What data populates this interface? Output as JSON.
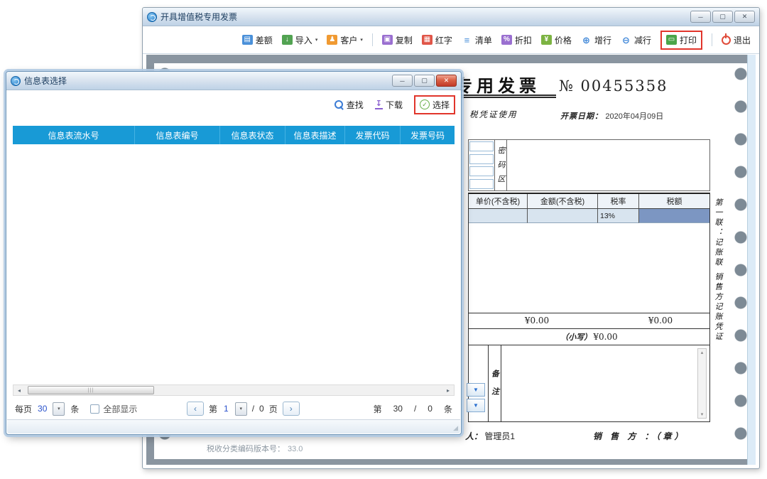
{
  "main_window": {
    "title": "开具增值税专用发票",
    "toolbar": {
      "balance": "差额",
      "import": "导入",
      "customer": "客户",
      "copy": "复制",
      "red_letter": "红字",
      "list": "清单",
      "discount": "折扣",
      "price": "价格",
      "add_row": "增行",
      "remove_row": "减行",
      "print": "打印",
      "exit": "退出"
    },
    "invoice": {
      "title_visible": "专用发票",
      "number_text": "№  00455358",
      "subtitle_visible": "税凭证使用",
      "date_label": "开票日期：",
      "date": "2020年04月09日",
      "password_area_label": "密码区",
      "columns": {
        "unit_price": "单价(不含税)",
        "amount": "金额(不含税)",
        "tax_rate": "税率",
        "tax": "税额"
      },
      "tax_rate_value": "13%",
      "amount_total": "¥0.00",
      "tax_total": "¥0.00",
      "small_total_label": "（小写）",
      "small_total": "¥0.00",
      "remarks_label": "备注",
      "issuer_label_visible": "人：",
      "issuer_value": "管理员1",
      "seller_stamp": "销 售 方 ：（章）",
      "copy_label": "第一联：记账联 销售方记账凭证"
    },
    "status_bar": {
      "label": "税收分类编码版本号：",
      "value": "33.0"
    }
  },
  "dialog": {
    "title": "信息表选择",
    "toolbar": {
      "search": "查找",
      "download": "下载",
      "select": "选择"
    },
    "table": {
      "headers": [
        "信息表流水号",
        "信息表编号",
        "信息表状态",
        "信息表描述",
        "发票代码",
        "发票号码"
      ]
    },
    "pagination": {
      "per_page_label": "每页",
      "per_page": "30",
      "per_page_unit": "条",
      "show_all_label": "全部显示",
      "page_label": "第",
      "current_page": "1",
      "page_divider": "/",
      "total_pages": "0",
      "page_unit": "页",
      "record_label": "第",
      "record_count": "30",
      "record_divider": "/",
      "record_total": "0",
      "record_unit": "条"
    }
  },
  "icons": {
    "balance": "▤",
    "import": "↓",
    "customer": "♟",
    "copy": "▣",
    "red_letter": "▦",
    "list": "≡",
    "discount": "%",
    "price": "¥",
    "add_row": "⊕",
    "remove_row": "⊖",
    "print": "▭",
    "download": "↧",
    "select": "✓",
    "caret": "▾",
    "caret_blue": "▼",
    "arrow_left": "◂",
    "arrow_right": "▸",
    "arrow_up": "▴",
    "arrow_down": "▾",
    "prev": "‹",
    "next": "›",
    "minimize": "─",
    "maximize": "▢",
    "close": "✕",
    "scroll_grip": "|||",
    "resize_grip": "◢"
  },
  "colors": {
    "header_blue": "#189ad6",
    "highlight_red": "#e1352b",
    "selected_cell": "#7c96c2",
    "paper_gray": "#8a95a0"
  }
}
